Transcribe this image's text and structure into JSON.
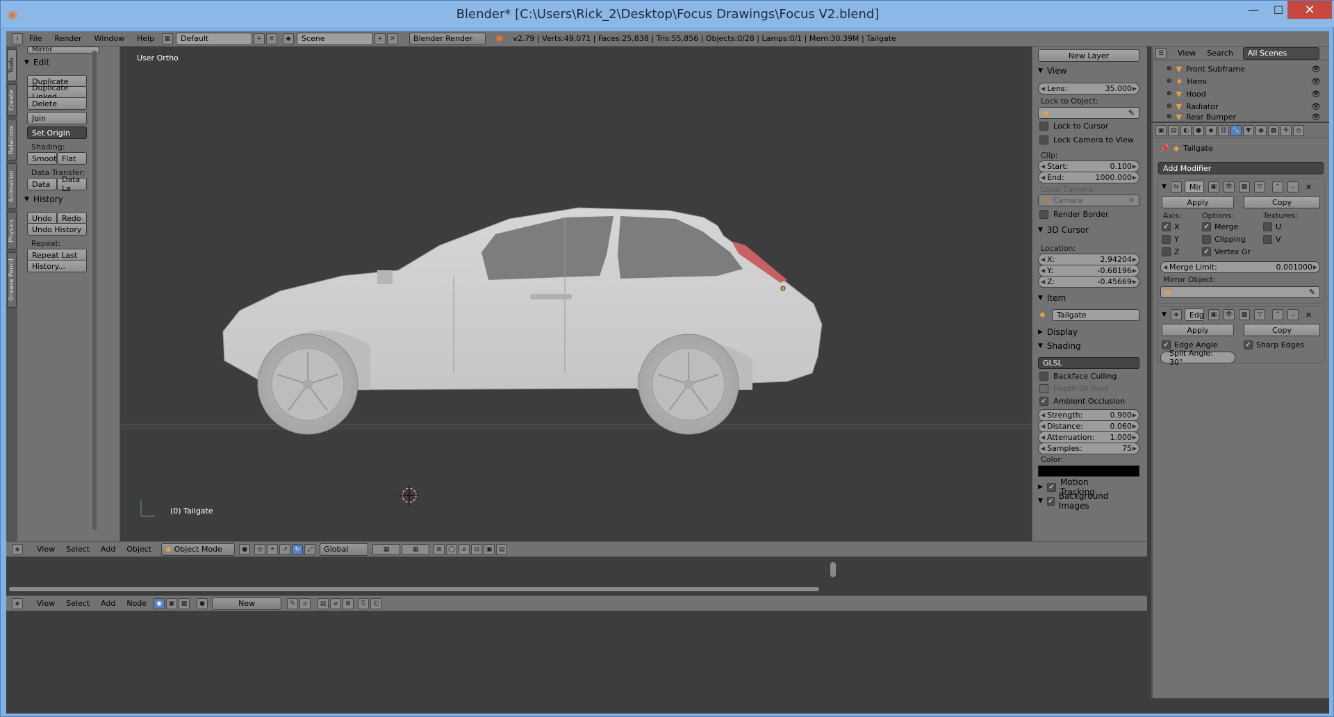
{
  "window": {
    "title": "Blender* [C:\\Users\\Rick_2\\Desktop\\Focus Drawings\\Focus V2.blend]",
    "min": "—",
    "max": "☐",
    "close": "✕"
  },
  "topbar": {
    "menus": [
      "File",
      "Render",
      "Window",
      "Help"
    ],
    "layout": "Default",
    "scene": "Scene",
    "engine": "Blender Render",
    "stats": "v2.79 | Verts:49,071 | Faces:25,838 | Tris:55,856 | Objects:0/28 | Lamps:0/1 | Mem:30.39M | Tailgate"
  },
  "tabs": [
    "Tools",
    "Create",
    "Relations",
    "Animation",
    "Physics",
    "Grease Pencil"
  ],
  "toolshelf": {
    "mirror": "Mirror",
    "edit_header": "Edit",
    "duplicate": "Duplicate",
    "duplicate_linked": "Duplicate Linked",
    "delete": "Delete",
    "join": "Join",
    "set_origin": "Set Origin",
    "shading_label": "Shading:",
    "smooth": "Smooth",
    "flat": "Flat",
    "data_transfer_label": "Data Transfer:",
    "data": "Data",
    "data_la": "Data La",
    "history_header": "History",
    "undo": "Undo",
    "redo": "Redo",
    "undo_history": "Undo History",
    "repeat_label": "Repeat:",
    "repeat_last": "Repeat Last",
    "history": "History..."
  },
  "viewport": {
    "view_label": "User Ortho",
    "object_label": "(0) Tailgate"
  },
  "npanel": {
    "new_layer": "New Layer",
    "view_header": "View",
    "lens_label": "Lens:",
    "lens": "35.000",
    "lock_to_object": "Lock to Object:",
    "lock_to_cursor": "Lock to Cursor",
    "lock_camera": "Lock Camera to View",
    "clip": "Clip:",
    "start_label": "Start:",
    "start": "0.100",
    "end_label": "End:",
    "end": "1000.000",
    "local_camera": "Local Camera:",
    "camera": "Camera",
    "render_border": "Render Border",
    "cursor_header": "3D Cursor",
    "location": "Location:",
    "x_label": "X:",
    "x": "2.94204",
    "y_label": "Y:",
    "y": "-0.68196",
    "z_label": "Z:",
    "z": "-0.45669",
    "item_header": "Item",
    "item_name": "Tailgate",
    "display_header": "Display",
    "shading_header": "Shading",
    "glsl": "GLSL",
    "backface": "Backface Culling",
    "depth_of_field": "Depth Of Field",
    "ambient_occlusion": "Ambient Occlusion",
    "strength_label": "Strength:",
    "strength": "0.900",
    "distance_label": "Distance:",
    "distance": "0.060",
    "attenuation_label": "Attenuation:",
    "attenuation": "1.000",
    "samples_label": "Samples:",
    "samples": "75",
    "color_label": "Color:",
    "motion_tracking": "Motion Tracking",
    "background_images": "Background Images"
  },
  "outliner": {
    "view": "View",
    "search": "Search",
    "scenes": "All Scenes",
    "items": [
      "Front Subframe",
      "Hemi",
      "Hood",
      "Radiator",
      "Rear Bumper"
    ]
  },
  "properties": {
    "object_name": "Tailgate",
    "add_modifier": "Add Modifier",
    "mod1_name": "Mir",
    "apply": "Apply",
    "copy": "Copy",
    "axis": "Axis:",
    "options": "Options:",
    "textures": "Textures:",
    "ax_x": "X",
    "ax_y": "Y",
    "ax_z": "Z",
    "merge": "Merge",
    "clipping": "Clipping",
    "vertex_gr": "Vertex Gr",
    "tex_u": "U",
    "tex_v": "V",
    "merge_limit_label": "Merge Limit:",
    "merge_limit": "0.001000",
    "mirror_object": "Mirror Object:",
    "mod2_name": "Edg",
    "apply2": "Apply",
    "copy2": "Copy",
    "edge_angle": "Edge Angle",
    "sharp_edges": "Sharp Edges",
    "split_angle": "Split Angle: 30°"
  },
  "vp_header": {
    "menus": [
      "View",
      "Select",
      "Add",
      "Object"
    ],
    "mode": "Object Mode",
    "orientation": "Global"
  },
  "node_header": {
    "menus": [
      "View",
      "Select",
      "Add",
      "Node"
    ],
    "new": "New"
  },
  "colors": {
    "accent": "#5680c2",
    "title_bar": "#8cb8e8",
    "close": "#c7483f",
    "panel": "#727272",
    "viewport": "#3d3d3d"
  }
}
